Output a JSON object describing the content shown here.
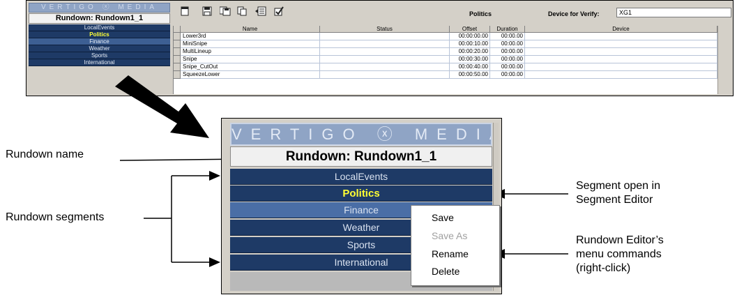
{
  "app": {
    "logo": "VERTIGO ⓧ MEDIA",
    "rundown_title": "Rundown: Rundown1_1",
    "segments": [
      "LocalEvents",
      "Politics",
      "Finance",
      "Weather",
      "Sports",
      "International"
    ],
    "selected_segment": "Politics",
    "segment_editor_title": "Politics",
    "device_label": "Device for Verify:",
    "device_value": "XG1",
    "toolbar_icons": [
      "new-icon",
      "save-icon",
      "save-as-icon",
      "copy-icon",
      "import-icon",
      "verify-icon"
    ],
    "grid": {
      "columns": [
        "Name",
        "Status",
        "Offset",
        "Duration",
        "Device"
      ],
      "rows": [
        {
          "name": "Lower3rd",
          "status": "",
          "offset": "00:00:00.00",
          "duration": "00:00.00",
          "device": ""
        },
        {
          "name": "MiniSnipe",
          "status": "",
          "offset": "00:00:10.00",
          "duration": "00:00.00",
          "device": ""
        },
        {
          "name": "MultiLineup",
          "status": "",
          "offset": "00:00:20.00",
          "duration": "00:00.00",
          "device": ""
        },
        {
          "name": "Snipe",
          "status": "",
          "offset": "00:00:30.00",
          "duration": "00:00.00",
          "device": ""
        },
        {
          "name": "Snipe_CutOut",
          "status": "",
          "offset": "00:00:40.00",
          "duration": "00:00.00",
          "device": ""
        },
        {
          "name": "SqueezeLower",
          "status": "",
          "offset": "00:00:50.00",
          "duration": "00:00.00",
          "device": ""
        }
      ]
    }
  },
  "zoom": {
    "logo": "VERTIGO ⓧ MEDIA",
    "rundown_title": "Rundown: Rundown1_1",
    "segments": [
      "LocalEvents",
      "Politics",
      "Finance",
      "Weather",
      "Sports",
      "International"
    ],
    "context_menu": [
      {
        "label": "Save",
        "enabled": true
      },
      {
        "label": "Save As",
        "enabled": false
      },
      {
        "label": "Rename",
        "enabled": true
      },
      {
        "label": "Delete",
        "enabled": true
      }
    ]
  },
  "callouts": {
    "rundown_name": "Rundown name",
    "rundown_segments": "Rundown segments",
    "segment_open_line1": "Segment open in",
    "segment_open_line2": "Segment Editor",
    "menu_line1": "Rundown Editor’s",
    "menu_line2": "menu commands",
    "menu_line3": "(right-click)"
  },
  "colors": {
    "segment_bg": "#1e3a66",
    "segment_highlight": "#4a6ea6",
    "selected_text": "#ffff33",
    "logo_bg": "#8fa4c5"
  }
}
